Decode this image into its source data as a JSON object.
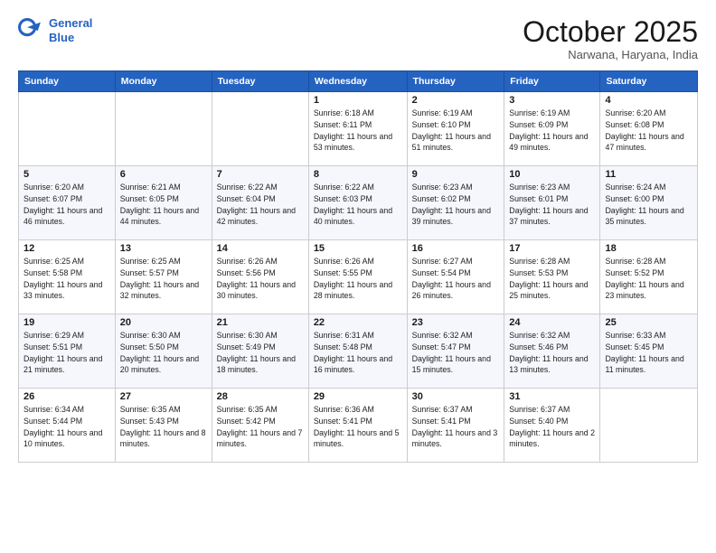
{
  "logo": {
    "line1": "General",
    "line2": "Blue"
  },
  "title": "October 2025",
  "subtitle": "Narwana, Haryana, India",
  "days_header": [
    "Sunday",
    "Monday",
    "Tuesday",
    "Wednesday",
    "Thursday",
    "Friday",
    "Saturday"
  ],
  "weeks": [
    [
      {
        "day": "",
        "info": ""
      },
      {
        "day": "",
        "info": ""
      },
      {
        "day": "",
        "info": ""
      },
      {
        "day": "1",
        "info": "Sunrise: 6:18 AM\nSunset: 6:11 PM\nDaylight: 11 hours and 53 minutes."
      },
      {
        "day": "2",
        "info": "Sunrise: 6:19 AM\nSunset: 6:10 PM\nDaylight: 11 hours and 51 minutes."
      },
      {
        "day": "3",
        "info": "Sunrise: 6:19 AM\nSunset: 6:09 PM\nDaylight: 11 hours and 49 minutes."
      },
      {
        "day": "4",
        "info": "Sunrise: 6:20 AM\nSunset: 6:08 PM\nDaylight: 11 hours and 47 minutes."
      }
    ],
    [
      {
        "day": "5",
        "info": "Sunrise: 6:20 AM\nSunset: 6:07 PM\nDaylight: 11 hours and 46 minutes."
      },
      {
        "day": "6",
        "info": "Sunrise: 6:21 AM\nSunset: 6:05 PM\nDaylight: 11 hours and 44 minutes."
      },
      {
        "day": "7",
        "info": "Sunrise: 6:22 AM\nSunset: 6:04 PM\nDaylight: 11 hours and 42 minutes."
      },
      {
        "day": "8",
        "info": "Sunrise: 6:22 AM\nSunset: 6:03 PM\nDaylight: 11 hours and 40 minutes."
      },
      {
        "day": "9",
        "info": "Sunrise: 6:23 AM\nSunset: 6:02 PM\nDaylight: 11 hours and 39 minutes."
      },
      {
        "day": "10",
        "info": "Sunrise: 6:23 AM\nSunset: 6:01 PM\nDaylight: 11 hours and 37 minutes."
      },
      {
        "day": "11",
        "info": "Sunrise: 6:24 AM\nSunset: 6:00 PM\nDaylight: 11 hours and 35 minutes."
      }
    ],
    [
      {
        "day": "12",
        "info": "Sunrise: 6:25 AM\nSunset: 5:58 PM\nDaylight: 11 hours and 33 minutes."
      },
      {
        "day": "13",
        "info": "Sunrise: 6:25 AM\nSunset: 5:57 PM\nDaylight: 11 hours and 32 minutes."
      },
      {
        "day": "14",
        "info": "Sunrise: 6:26 AM\nSunset: 5:56 PM\nDaylight: 11 hours and 30 minutes."
      },
      {
        "day": "15",
        "info": "Sunrise: 6:26 AM\nSunset: 5:55 PM\nDaylight: 11 hours and 28 minutes."
      },
      {
        "day": "16",
        "info": "Sunrise: 6:27 AM\nSunset: 5:54 PM\nDaylight: 11 hours and 26 minutes."
      },
      {
        "day": "17",
        "info": "Sunrise: 6:28 AM\nSunset: 5:53 PM\nDaylight: 11 hours and 25 minutes."
      },
      {
        "day": "18",
        "info": "Sunrise: 6:28 AM\nSunset: 5:52 PM\nDaylight: 11 hours and 23 minutes."
      }
    ],
    [
      {
        "day": "19",
        "info": "Sunrise: 6:29 AM\nSunset: 5:51 PM\nDaylight: 11 hours and 21 minutes."
      },
      {
        "day": "20",
        "info": "Sunrise: 6:30 AM\nSunset: 5:50 PM\nDaylight: 11 hours and 20 minutes."
      },
      {
        "day": "21",
        "info": "Sunrise: 6:30 AM\nSunset: 5:49 PM\nDaylight: 11 hours and 18 minutes."
      },
      {
        "day": "22",
        "info": "Sunrise: 6:31 AM\nSunset: 5:48 PM\nDaylight: 11 hours and 16 minutes."
      },
      {
        "day": "23",
        "info": "Sunrise: 6:32 AM\nSunset: 5:47 PM\nDaylight: 11 hours and 15 minutes."
      },
      {
        "day": "24",
        "info": "Sunrise: 6:32 AM\nSunset: 5:46 PM\nDaylight: 11 hours and 13 minutes."
      },
      {
        "day": "25",
        "info": "Sunrise: 6:33 AM\nSunset: 5:45 PM\nDaylight: 11 hours and 11 minutes."
      }
    ],
    [
      {
        "day": "26",
        "info": "Sunrise: 6:34 AM\nSunset: 5:44 PM\nDaylight: 11 hours and 10 minutes."
      },
      {
        "day": "27",
        "info": "Sunrise: 6:35 AM\nSunset: 5:43 PM\nDaylight: 11 hours and 8 minutes."
      },
      {
        "day": "28",
        "info": "Sunrise: 6:35 AM\nSunset: 5:42 PM\nDaylight: 11 hours and 7 minutes."
      },
      {
        "day": "29",
        "info": "Sunrise: 6:36 AM\nSunset: 5:41 PM\nDaylight: 11 hours and 5 minutes."
      },
      {
        "day": "30",
        "info": "Sunrise: 6:37 AM\nSunset: 5:41 PM\nDaylight: 11 hours and 3 minutes."
      },
      {
        "day": "31",
        "info": "Sunrise: 6:37 AM\nSunset: 5:40 PM\nDaylight: 11 hours and 2 minutes."
      },
      {
        "day": "",
        "info": ""
      }
    ]
  ]
}
